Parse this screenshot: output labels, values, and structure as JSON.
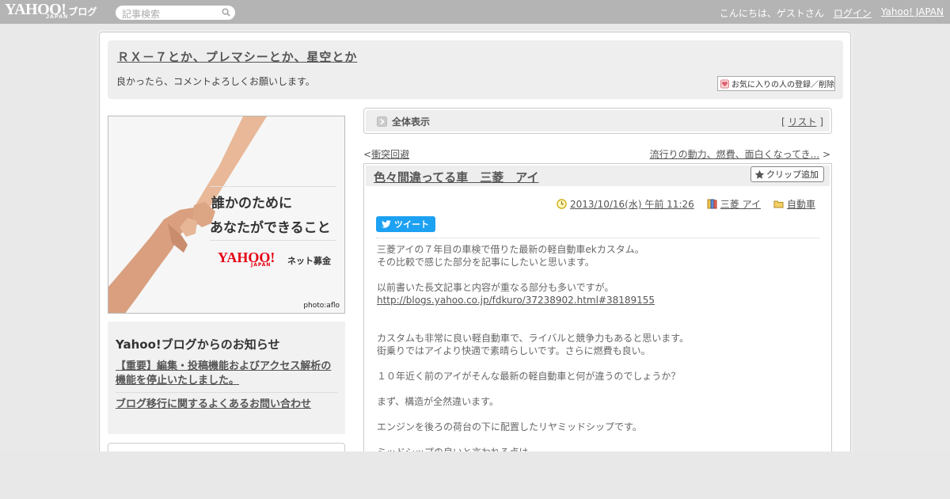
{
  "topbar": {
    "logo_text": "YAHOO!",
    "logo_sub": "JAPAN",
    "logo_blog": "ブログ",
    "search_placeholder": "記事検索",
    "greeting": "こんにちは、ゲストさん",
    "login": "ログイン",
    "yahoo_japan": "Yahoo! JAPAN"
  },
  "header": {
    "title": "ＲＸ－７とか、プレマシーとか、星空とか",
    "description": "良かったら、コメントよろしくお願いします。",
    "fav_button": "お気に入りの人の登録／削除"
  },
  "ad": {
    "line1": "誰かのために",
    "line2": "あなたができること",
    "brand": "YAHOO!",
    "brand_sub": "JAPAN",
    "service": "ネット募金",
    "credit": "photo:aflo"
  },
  "notice": {
    "title": "Yahoo!ブログからのお知らせ",
    "links": [
      "【重要】編集・投稿機能およびアクセス解析の機能を停止いたしました。",
      "ブログ移行に関するよくあるお問い合わせ"
    ]
  },
  "viewbar": {
    "label": "全体表示",
    "list_open": "[",
    "list_link": "リスト",
    "list_close": "]"
  },
  "nav": {
    "prev_arrow": "<",
    "prev_label": "衝突回避",
    "next_label": "流行りの動力、燃費、面白くなってき...",
    "next_arrow": ">"
  },
  "article": {
    "title": "色々間違ってる車　三菱　アイ",
    "clip_button": "クリップ追加",
    "date": "2013/10/16(水) 午前 11:26",
    "tag": "三菱 アイ",
    "category": "自動車",
    "tweet": "ツイート",
    "paragraphs": {
      "p1": "三菱アイの７年目の車検で借りた最新の軽自動車ekカスタム。",
      "p2": "その比較で感じた部分を記事にしたいと思います。",
      "p3": "以前書いた長文記事と内容が重なる部分も多いですが。",
      "link": "http://blogs.yahoo.co.jp/fdkuro/37238902.html#38189155",
      "p4": "カスタムも非常に良い軽自動車で、ライバルと競争力もあると思います。",
      "p5": "街乗りではアイより快適で素晴らしいです。さらに燃費も良い。",
      "p6": "１０年近く前のアイがそんな最新の軽自動車と何が違うのでしょうか？",
      "p7": "まず、構造が全然違います。",
      "p8": "エンジンを後ろの荷台の下に配置したリヤミッドシップです。",
      "p9": "ミッドシップの良いと言われる点は"
    }
  },
  "colors": {
    "topbar": "#b4b4b4",
    "tweet": "#1da1f2",
    "yahoo_red": "#e60012"
  }
}
